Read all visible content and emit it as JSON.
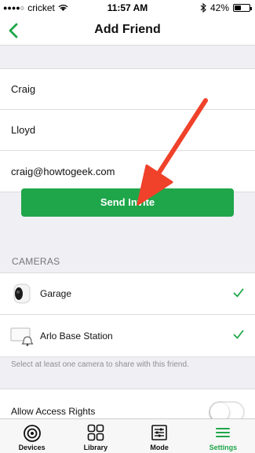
{
  "status_bar": {
    "carrier": "cricket",
    "time": "11:57 AM",
    "battery": "42%",
    "battery_level": 0.42
  },
  "nav": {
    "title": "Add Friend"
  },
  "form": {
    "first_name": "Craig",
    "last_name": "Lloyd",
    "email": "craig@howtogeek.com"
  },
  "send_button": "Send Invite",
  "cameras_section": {
    "header": "CAMERAS",
    "items": [
      {
        "label": "Garage",
        "checked": true,
        "icon": "camera-icon"
      },
      {
        "label": "Arlo Base Station",
        "checked": true,
        "icon": "base-station-icon"
      }
    ],
    "hint": "Select at least one camera to share with this friend."
  },
  "access": {
    "label": "Allow Access Rights",
    "enabled": false
  },
  "tabs": [
    {
      "label": "Devices",
      "icon": "devices-icon",
      "active": false
    },
    {
      "label": "Library",
      "icon": "library-icon",
      "active": false
    },
    {
      "label": "Mode",
      "icon": "mode-icon",
      "active": false
    },
    {
      "label": "Settings",
      "icon": "settings-icon",
      "active": true
    }
  ],
  "colors": {
    "accent": "#1fa64a",
    "annotation_arrow": "#f0412a"
  }
}
